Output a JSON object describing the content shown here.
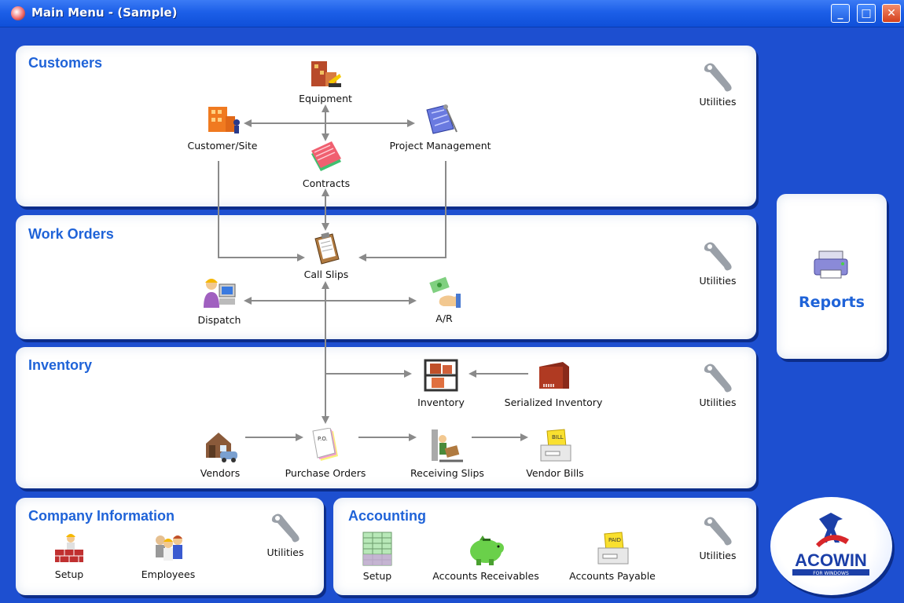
{
  "window": {
    "title": "Main Menu - (Sample)"
  },
  "customers": {
    "title": "Customers",
    "equipment": "Equipment",
    "customer_site": "Customer/Site",
    "project_management": "Project Management",
    "contracts": "Contracts",
    "utilities": "Utilities"
  },
  "work_orders": {
    "title": "Work Orders",
    "call_slips": "Call Slips",
    "dispatch": "Dispatch",
    "ar": "A/R",
    "utilities": "Utilities"
  },
  "inventory": {
    "title": "Inventory",
    "inventory": "Inventory",
    "serialized_inventory": "Serialized Inventory",
    "vendors": "Vendors",
    "purchase_orders": "Purchase Orders",
    "receiving_slips": "Receiving Slips",
    "vendor_bills": "Vendor Bills",
    "utilities": "Utilities"
  },
  "company": {
    "title": "Company Information",
    "setup": "Setup",
    "employees": "Employees",
    "utilities": "Utilities"
  },
  "accounting": {
    "title": "Accounting",
    "setup": "Setup",
    "accounts_receivables": "Accounts Receivables",
    "accounts_payable": "Accounts Payable",
    "utilities": "Utilities"
  },
  "reports": {
    "label": "Reports"
  },
  "logo": {
    "text": "ACOWIN",
    "tagline": "FOR WINDOWS"
  },
  "colors": {
    "background": "#1d4fd0",
    "title_blue": "#1f63d8",
    "panel": "#ffffff"
  }
}
